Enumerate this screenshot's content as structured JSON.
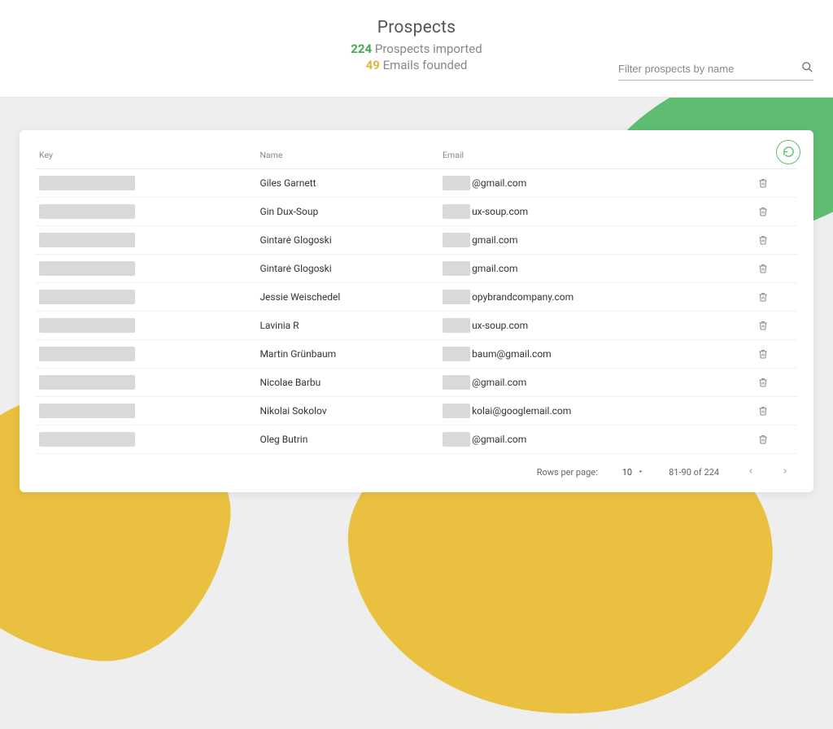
{
  "header": {
    "title": "Prospects",
    "imported_count": "224",
    "imported_label": "Prospects imported",
    "emails_count": "49",
    "emails_label": "Emails founded",
    "search_placeholder": "Filter prospects by name"
  },
  "table": {
    "columns": {
      "key": "Key",
      "name": "Name",
      "email": "Email"
    },
    "rows": [
      {
        "name": "Giles Garnett",
        "email_suffix": "@gmail.com"
      },
      {
        "name": "Gin Dux-Soup",
        "email_suffix": "ux-soup.com"
      },
      {
        "name": "Gintarė Glogoski",
        "email_suffix": "gmail.com"
      },
      {
        "name": "Gintarė Glogoski",
        "email_suffix": "gmail.com"
      },
      {
        "name": "Jessie Weischedel",
        "email_suffix": "opybrandcompany.com"
      },
      {
        "name": "Lavinia R",
        "email_suffix": "ux-soup.com"
      },
      {
        "name": "Martin Grünbaum",
        "email_suffix": "baum@gmail.com"
      },
      {
        "name": "Nicolae Barbu",
        "email_suffix": "@gmail.com"
      },
      {
        "name": "Nikolai Sokolov",
        "email_suffix": "kolai@googlemail.com"
      },
      {
        "name": "Oleg Butrin",
        "email_suffix": "@gmail.com"
      }
    ]
  },
  "pagination": {
    "rpp_label": "Rows per page:",
    "rpp_value": "10",
    "range": "81-90 of 224"
  }
}
